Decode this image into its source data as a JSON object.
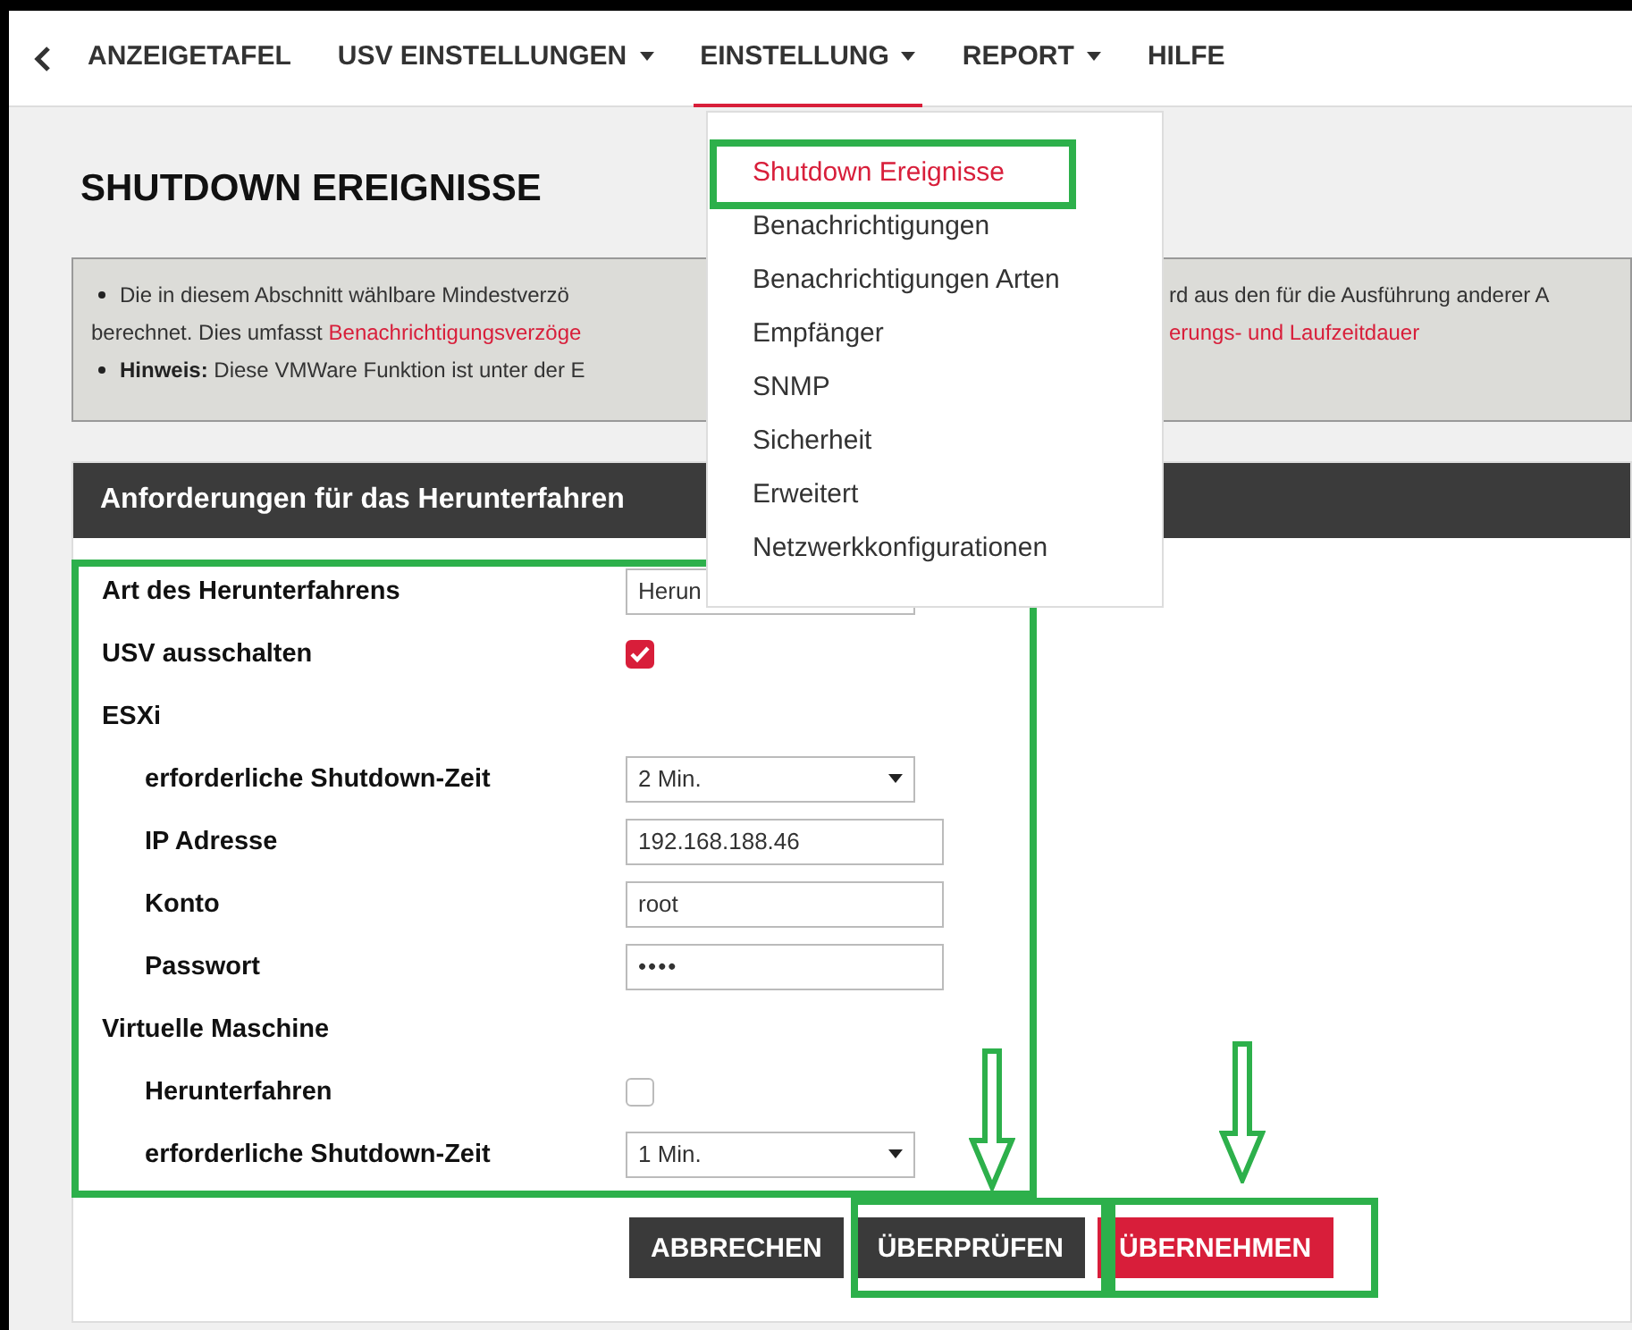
{
  "nav": {
    "items": [
      {
        "label": "ANZEIGETAFEL",
        "has_menu": false,
        "selected": false
      },
      {
        "label": "USV EINSTELLUNGEN",
        "has_menu": true,
        "selected": false
      },
      {
        "label": "EINSTELLUNG",
        "has_menu": true,
        "selected": true
      },
      {
        "label": "REPORT",
        "has_menu": true,
        "selected": false
      },
      {
        "label": "HILFE",
        "has_menu": false,
        "selected": false
      }
    ]
  },
  "menu": {
    "items": [
      {
        "label": "Shutdown Ereignisse",
        "selected": true
      },
      {
        "label": "Benachrichtigungen",
        "selected": false
      },
      {
        "label": "Benachrichtigungen Arten",
        "selected": false
      },
      {
        "label": "Empfänger",
        "selected": false
      },
      {
        "label": "SNMP",
        "selected": false
      },
      {
        "label": "Sicherheit",
        "selected": false
      },
      {
        "label": "Erweitert",
        "selected": false
      },
      {
        "label": "Netzwerkkonfigurationen",
        "selected": false
      }
    ]
  },
  "page_title": "SHUTDOWN EREIGNISSE",
  "notice": {
    "lines": [
      {
        "left": "Die in diesem Abschnitt wählbare Mindestverzö",
        "right": "rd aus den für die Ausführung anderer A",
        "right_is_link": false,
        "bullet": true
      },
      {
        "left": "berechnet. Dies umfasst",
        "left_link": "Benachrichtigungsverzöge",
        "right": "erungs- und Laufzeitdauer",
        "right_is_link": true,
        "bullet": false
      },
      {
        "left": "**Hinweis:** Diese VMWare Funktion ist unter der E",
        "bullet": true
      }
    ]
  },
  "panel": {
    "title": "Anforderungen für das Herunterfahren",
    "rows": [
      {
        "kind": "select",
        "label": "Art des Herunterfahrens",
        "value": "Herun"
      },
      {
        "kind": "checkbox",
        "label": "USV ausschalten",
        "checked": true
      },
      {
        "kind": "group",
        "label": "ESXi",
        "children": [
          {
            "kind": "select",
            "label": "erforderliche Shutdown-Zeit",
            "value": "2 Min.",
            "show_caret": true
          },
          {
            "kind": "text",
            "label": "IP Adresse",
            "value": "192.168.188.46"
          },
          {
            "kind": "text",
            "label": "Konto",
            "value": "root"
          },
          {
            "kind": "password",
            "label": "Passwort",
            "value": "••••"
          }
        ]
      },
      {
        "kind": "group",
        "label": "Virtuelle Maschine",
        "children": [
          {
            "kind": "checkbox",
            "label": "Herunterfahren",
            "checked": false
          },
          {
            "kind": "select",
            "label": "erforderliche Shutdown-Zeit",
            "value": "1 Min.",
            "show_caret": true
          }
        ]
      }
    ]
  },
  "buttons": [
    {
      "label": "ABBRECHEN",
      "kind": "dark"
    },
    {
      "label": "ÜBERPRÜFEN",
      "kind": "dark"
    },
    {
      "label": "ÜBERNEHMEN",
      "kind": "primary"
    }
  ]
}
